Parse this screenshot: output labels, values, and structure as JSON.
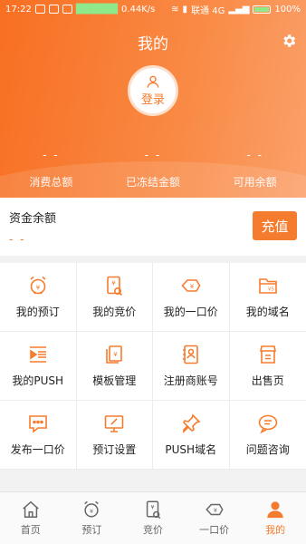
{
  "status_bar": {
    "time": "17:22",
    "speed": "0.44K/s",
    "carrier": "联通 4G",
    "battery": "100%",
    "green_text": "██████"
  },
  "header": {
    "title": "我的",
    "login_label": "登录",
    "stats": [
      {
        "value": "- -",
        "label": "消费总额"
      },
      {
        "value": "- -",
        "label": "已冻结金额"
      },
      {
        "value": "- -",
        "label": "可用余额"
      }
    ]
  },
  "balance": {
    "label": "资金余额",
    "value": "- -",
    "recharge_label": "充值"
  },
  "grid": [
    {
      "label": "我的预订",
      "icon": "alarm-clock-icon"
    },
    {
      "label": "我的竞价",
      "icon": "bid-document-icon"
    },
    {
      "label": "我的一口价",
      "icon": "price-tag-icon"
    },
    {
      "label": "我的域名",
      "icon": "domain-folder-icon"
    },
    {
      "label": "我的PUSH",
      "icon": "push-list-icon"
    },
    {
      "label": "模板管理",
      "icon": "template-icon"
    },
    {
      "label": "注册商账号",
      "icon": "registrar-book-icon"
    },
    {
      "label": "出售页",
      "icon": "sale-page-icon"
    },
    {
      "label": "发布一口价",
      "icon": "publish-chat-icon"
    },
    {
      "label": "预订设置",
      "icon": "monitor-edit-icon"
    },
    {
      "label": "PUSH域名",
      "icon": "pin-icon"
    },
    {
      "label": "问题咨询",
      "icon": "question-chat-icon"
    }
  ],
  "tabs": [
    {
      "label": "首页",
      "icon": "home-icon",
      "active": false
    },
    {
      "label": "预订",
      "icon": "alarm-clock-icon",
      "active": false
    },
    {
      "label": "竞价",
      "icon": "bid-document-icon",
      "active": false
    },
    {
      "label": "一口价",
      "icon": "price-tag-icon",
      "active": false
    },
    {
      "label": "我的",
      "icon": "user-icon",
      "active": true
    }
  ],
  "colors": {
    "accent": "#f57c2e",
    "header_start": "#f86f22",
    "header_end": "#fba06a"
  }
}
